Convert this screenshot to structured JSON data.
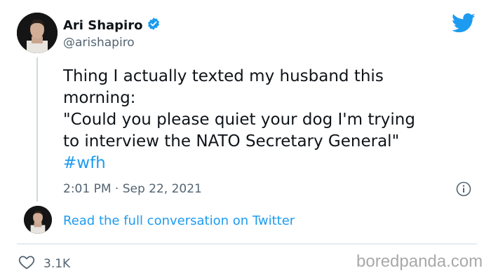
{
  "author": {
    "display_name": "Ari Shapiro",
    "handle": "@arishapiro",
    "verified": true,
    "verified_icon": "verified-badge-icon",
    "avatar_icon": "profile-photo"
  },
  "tweet": {
    "lines": [
      "Thing I actually texted my husband this",
      "morning:",
      "\"Could you please quiet your dog I'm trying",
      "to interview the NATO Secretary General\""
    ],
    "hashtag": "#wfh",
    "time": "2:01 PM",
    "separator": "·",
    "date": "Sep 22, 2021"
  },
  "conversation": {
    "link_text": "Read the full conversation on Twitter"
  },
  "engagement": {
    "likes": "3.1K",
    "like_icon": "heart-icon"
  },
  "icons": {
    "brand": "twitter-bird-icon",
    "info": "info-icon"
  },
  "watermark": "boredpanda.com",
  "colors": {
    "link": "#1d9bf0",
    "secondary_text": "#536471",
    "primary_text": "#0f1419",
    "verified": "#1d9bf0",
    "divider": "#cfd9de"
  }
}
